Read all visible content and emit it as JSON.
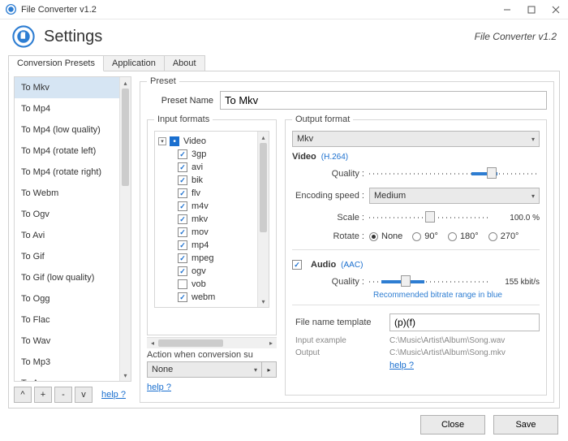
{
  "window": {
    "title": "File Converter v1.2"
  },
  "header": {
    "title": "Settings",
    "subtitle": "File Converter v1.2"
  },
  "tabs": [
    {
      "label": "Conversion Presets",
      "active": true
    },
    {
      "label": "Application",
      "active": false
    },
    {
      "label": "About",
      "active": false
    }
  ],
  "presets": {
    "items": [
      "To Mkv",
      "To Mp4",
      "To Mp4 (low quality)",
      "To Mp4 (rotate left)",
      "To Mp4 (rotate right)",
      "To Webm",
      "To Ogv",
      "To Avi",
      "To Gif",
      "To Gif (low quality)",
      "To Ogg",
      "To Flac",
      "To Wav",
      "To Mp3",
      "To Aac"
    ],
    "selected_index": 0,
    "buttons": {
      "up": "^",
      "add": "+",
      "remove": "-",
      "down": "v"
    },
    "help_label": "help ?"
  },
  "preset_panel": {
    "legend": "Preset",
    "name_label": "Preset Name",
    "name_value": "To Mkv",
    "input_formats": {
      "legend": "Input formats",
      "root_label": "Video",
      "items": [
        {
          "label": "3gp",
          "checked": true
        },
        {
          "label": "avi",
          "checked": true
        },
        {
          "label": "bik",
          "checked": true
        },
        {
          "label": "flv",
          "checked": true
        },
        {
          "label": "m4v",
          "checked": true
        },
        {
          "label": "mkv",
          "checked": true
        },
        {
          "label": "mov",
          "checked": true
        },
        {
          "label": "mp4",
          "checked": true
        },
        {
          "label": "mpeg",
          "checked": true
        },
        {
          "label": "ogv",
          "checked": true
        },
        {
          "label": "vob",
          "checked": false
        },
        {
          "label": "webm",
          "checked": true
        }
      ],
      "action_label": "Action when conversion su",
      "action_value": "None",
      "help_label": "help ?"
    },
    "output": {
      "legend": "Output format",
      "format_value": "Mkv",
      "video": {
        "label": "Video",
        "codec": "(H.264)",
        "quality_label": "Quality :",
        "encoding_label": "Encoding speed :",
        "encoding_value": "Medium",
        "scale_label": "Scale :",
        "scale_value": "100.0 %",
        "rotate_label": "Rotate :",
        "rotate_options": [
          "None",
          "90°",
          "180°",
          "270°"
        ],
        "rotate_selected": 0
      },
      "audio": {
        "checked": true,
        "label": "Audio",
        "codec": "(AAC)",
        "quality_label": "Quality :",
        "quality_value": "155 kbit/s",
        "recommended": "Recommended bitrate range in blue"
      },
      "template": {
        "label": "File name template",
        "value": "(p)(f)",
        "input_example_k": "Input example",
        "input_example_v": "C:\\Music\\Artist\\Album\\Song.wav",
        "output_k": "Output",
        "output_v": "C:\\Music\\Artist\\Album\\Song.mkv",
        "help_label": "help ?"
      }
    }
  },
  "footer": {
    "close": "Close",
    "save": "Save"
  }
}
